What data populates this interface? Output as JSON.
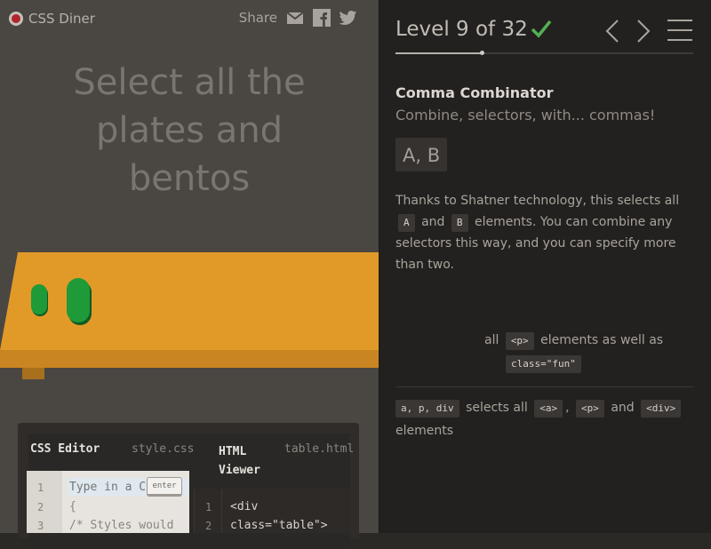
{
  "app": {
    "name": "CSS Diner"
  },
  "share": {
    "label": "Share",
    "icons": [
      "envelope-icon",
      "facebook-icon",
      "twitter-icon"
    ]
  },
  "instruction": "Select all the plates and bentos",
  "level": {
    "title": "Level 9 of 32",
    "completed": true,
    "progress_fraction": 0.29
  },
  "selector": {
    "name": "Comma Combinator",
    "title": "Combine, selectors, with... commas!",
    "syntax": "A, B",
    "hint_parts": [
      "Thanks to Shatner technology, this selects all",
      "A",
      "and",
      "B",
      "elements. You can combine any selectors this way, and you can specify more than two."
    ]
  },
  "examples": {
    "title": "",
    "ex1_parts": [
      "all",
      "<p>",
      "elements as well as",
      "class=\"fun\""
    ],
    "ex2_parts": [
      "a, p, div",
      "selects all",
      "<a>",
      ",",
      "<p>",
      "and",
      "<div>",
      "elements"
    ]
  },
  "editor": {
    "css_title": "CSS Editor",
    "css_file": "style.css",
    "html_title": "HTML Viewer",
    "html_file": "table.html",
    "css_placeholder": "Type in a C",
    "css_lines": [
      "{",
      "/* Styles would"
    ],
    "line_numbers": [
      "1",
      "2",
      "3"
    ],
    "enter_label": "enter",
    "html_line_numbers": [
      "1",
      "2"
    ],
    "html_lines": [
      "<div",
      "class=\"table\">"
    ]
  },
  "colors": {
    "accent_green": "#52b153",
    "table_orange": "#e19a28",
    "item_green": "#1f9a39",
    "logo_red": "#b0242b"
  }
}
